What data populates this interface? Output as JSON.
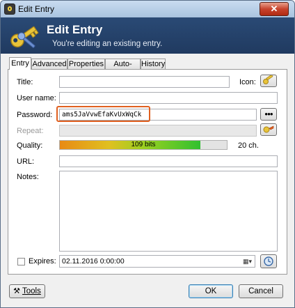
{
  "window": {
    "title": "Edit Entry",
    "close_glyph": "✕"
  },
  "banner": {
    "heading": "Edit Entry",
    "subtitle": "You're editing an existing entry."
  },
  "tabs": [
    {
      "label": "Entry",
      "active": true
    },
    {
      "label": "Advanced"
    },
    {
      "label": "Properties"
    },
    {
      "label": "Auto-Type"
    },
    {
      "label": "History"
    }
  ],
  "form": {
    "title_label": "Title:",
    "title_value": "",
    "icon_label": "Icon:",
    "username_label": "User name:",
    "username_value": "",
    "password_label": "Password:",
    "password_value": "ams5JaVvwEfaKvUxWqCk",
    "show_password_glyph": "●●●",
    "repeat_label": "Repeat:",
    "repeat_value": "",
    "quality_label": "Quality:",
    "quality_text": "109 bits",
    "quality_fraction": 0.84,
    "chars_text": "20 ch.",
    "url_label": "URL:",
    "url_value": "",
    "notes_label": "Notes:",
    "notes_value": "",
    "expires_label": "Expires:",
    "expires_value": "02.11.2016  0:00:00",
    "expires_checked": false
  },
  "buttons": {
    "tools": "Tools",
    "ok": "OK",
    "cancel": "Cancel"
  },
  "colors": {
    "highlight": "#e06020",
    "banner": "#203a60",
    "quality_start": "#e88a14",
    "quality_end": "#30c030"
  },
  "icons": [
    "lock-icon",
    "key-icon",
    "key-small-icon",
    "generate-password-icon",
    "calendar-icon",
    "tools-icon"
  ]
}
